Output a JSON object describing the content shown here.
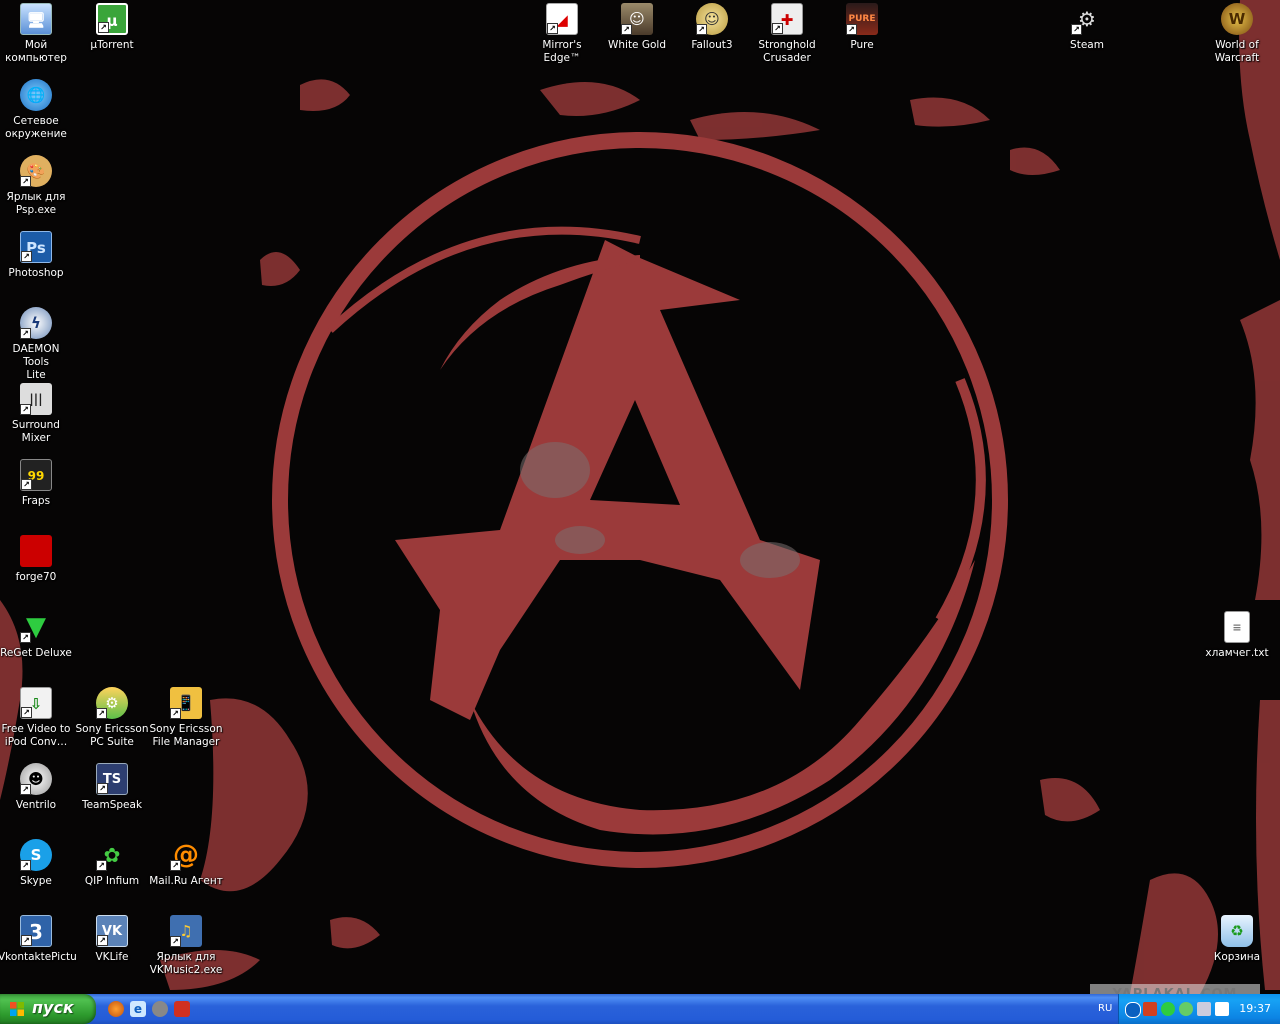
{
  "desktop": {
    "icons": [
      {
        "id": "my-computer",
        "label": "Мой\nкомпьютер"
      },
      {
        "id": "utorrent",
        "label": "µTorrent"
      },
      {
        "id": "network",
        "label": "Сетевое\nокружение"
      },
      {
        "id": "psp",
        "label": "Ярлык для\nPsp.exe"
      },
      {
        "id": "photoshop",
        "label": "Photoshop"
      },
      {
        "id": "daemon",
        "label": "DAEMON Tools\nLite"
      },
      {
        "id": "surround",
        "label": "Surround\nMixer"
      },
      {
        "id": "fraps",
        "label": "Fraps"
      },
      {
        "id": "forge",
        "label": "forge70"
      },
      {
        "id": "reget",
        "label": "ReGet Deluxe"
      },
      {
        "id": "freevideo",
        "label": "Free Video to\niPod Conv…"
      },
      {
        "id": "se-pcsuite",
        "label": "Sony Ericsson\nPC Suite"
      },
      {
        "id": "se-filemanager",
        "label": "Sony Ericsson\nFile Manager"
      },
      {
        "id": "ventrilo",
        "label": "Ventrilo"
      },
      {
        "id": "teamspeak",
        "label": "TeamSpeak"
      },
      {
        "id": "skype",
        "label": "Skype"
      },
      {
        "id": "qip",
        "label": "QIP Infium"
      },
      {
        "id": "mailru",
        "label": "Mail.Ru Агент"
      },
      {
        "id": "vkontakte",
        "label": "VkontaktePictu"
      },
      {
        "id": "vklife",
        "label": "VKLife"
      },
      {
        "id": "vkmusic",
        "label": "Ярлык для\nVKMusic2.exe"
      },
      {
        "id": "mirrors-edge",
        "label": "Mirror's\nEdge™"
      },
      {
        "id": "white-gold",
        "label": "White Gold"
      },
      {
        "id": "fallout3",
        "label": "Fallout3"
      },
      {
        "id": "stronghold",
        "label": "Stronghold\nCrusader"
      },
      {
        "id": "pure",
        "label": "Pure"
      },
      {
        "id": "steam",
        "label": "Steam"
      },
      {
        "id": "wow",
        "label": "World of\nWarcraft"
      },
      {
        "id": "hlamcher",
        "label": "хламчег.txt"
      },
      {
        "id": "recycle",
        "label": "Корзина"
      }
    ]
  },
  "taskbar": {
    "start_label": "пуск",
    "language": "RU",
    "clock": "19:37",
    "quick_launch": [
      "firefox-icon",
      "ie-icon",
      "steam-icon",
      "app-icon"
    ]
  },
  "wallpaper": {
    "colors": {
      "background": "#060505",
      "symbol": "#9b3a3a",
      "splatter": "#8a3434"
    }
  },
  "watermark": "YAPLAKAL.COM"
}
